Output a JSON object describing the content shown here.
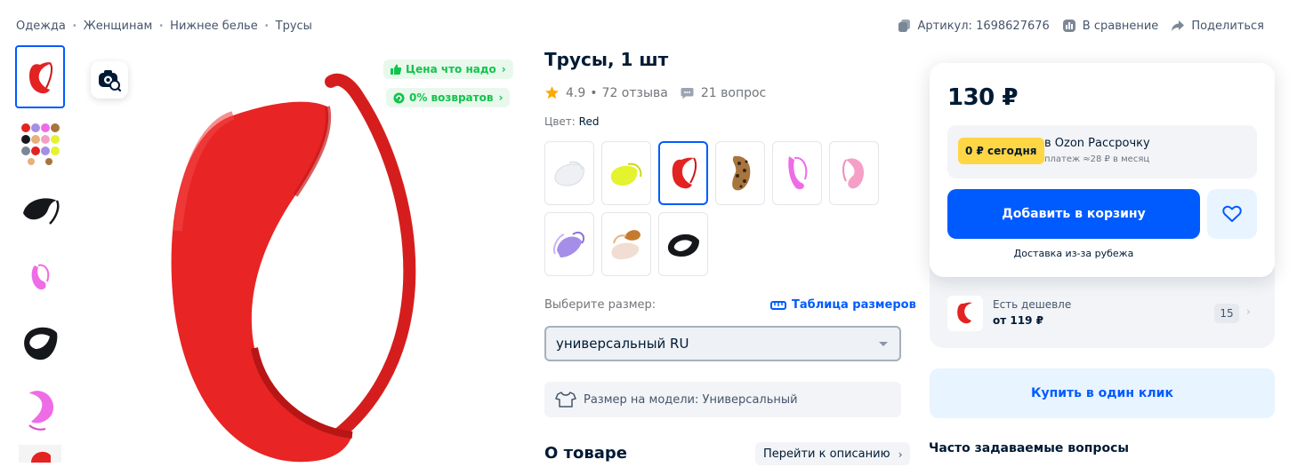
{
  "breadcrumb": [
    "Одежда",
    "Женщинам",
    "Нижнее белье",
    "Трусы"
  ],
  "top_actions": {
    "sku_label": "Артикул: 1698627676",
    "compare_label": "В сравнение",
    "share_label": "Поделиться"
  },
  "badges": {
    "price_label": "Цена что надо",
    "returns_label": "0% возвратов"
  },
  "product": {
    "title": "Трусы, 1 шт",
    "rating": "4.9",
    "reviews": "72 отзыва",
    "questions": "21 вопрос",
    "color_label": "Цвет:",
    "color_value": "Red"
  },
  "swatches": [
    {
      "color": "#f3f5f8",
      "name": "white"
    },
    {
      "color": "#e4f230",
      "name": "yellow"
    },
    {
      "color": "#e32222",
      "name": "red",
      "selected": true
    },
    {
      "color": "#a7753e",
      "name": "leopard"
    },
    {
      "color": "#ee6ce6",
      "name": "violet-pink"
    },
    {
      "color": "#f59fc6",
      "name": "pink"
    },
    {
      "color": "#a58ee8",
      "name": "lavender"
    },
    {
      "color": "#e8b07a",
      "name": "beige"
    },
    {
      "color": "#16171b",
      "name": "black"
    }
  ],
  "size": {
    "label": "Выберите размер:",
    "table_link": "Таблица размеров",
    "selected": "универсальный RU",
    "model_size": "Размер на модели: Универсальный"
  },
  "about": {
    "title": "О товаре",
    "to_description": "Перейти к описанию"
  },
  "buy": {
    "price": "130 ₽",
    "installment_pill": "0 ₽ сегодня",
    "installment_main": "в Ozon Рассрочку",
    "installment_sub": "платеж ≈28 ₽ в месяц",
    "add_to_cart": "Добавить в корзину",
    "delivery": "Доставка из-за рубежа",
    "cheaper_label": "Есть дешевле",
    "cheaper_price": "от 119 ₽",
    "cheaper_count": "15",
    "one_click": "Купить в один клик",
    "faq_title": "Часто задаваемые вопросы"
  },
  "colors": {
    "accent": "#005bff",
    "green": "#10c44c",
    "yellow_pill": "#ffd644",
    "product_red": "#e32222"
  },
  "icons": {
    "visual_search": "camera-search-icon",
    "star": "star-icon",
    "question": "chat-bubble-icon",
    "ruler": "ruler-icon",
    "tshirt": "tshirt-icon",
    "heart": "heart-icon",
    "thumbs_up": "thumbs-up-icon",
    "return": "return-icon"
  }
}
